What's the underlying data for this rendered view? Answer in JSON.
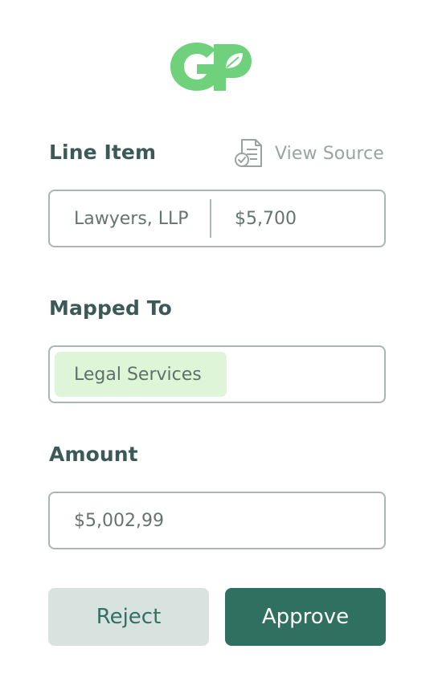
{
  "brand": {
    "logo_text": "GP",
    "logo_color": "#6fd17b"
  },
  "line_item": {
    "label": "Line Item",
    "view_source_label": "View Source",
    "vendor": "Lawyers, LLP",
    "amount": "$5,700"
  },
  "mapped_to": {
    "label": "Mapped To",
    "tag": "Legal Services"
  },
  "amount": {
    "label": "Amount",
    "value": "$5,002,99"
  },
  "actions": {
    "reject_label": "Reject",
    "approve_label": "Approve"
  },
  "colors": {
    "label_text": "#3b5a57",
    "border": "#aab5b4",
    "tag_bg": "#dff5d8",
    "reject_bg": "#d8e3e0",
    "approve_bg": "#2f7060"
  }
}
